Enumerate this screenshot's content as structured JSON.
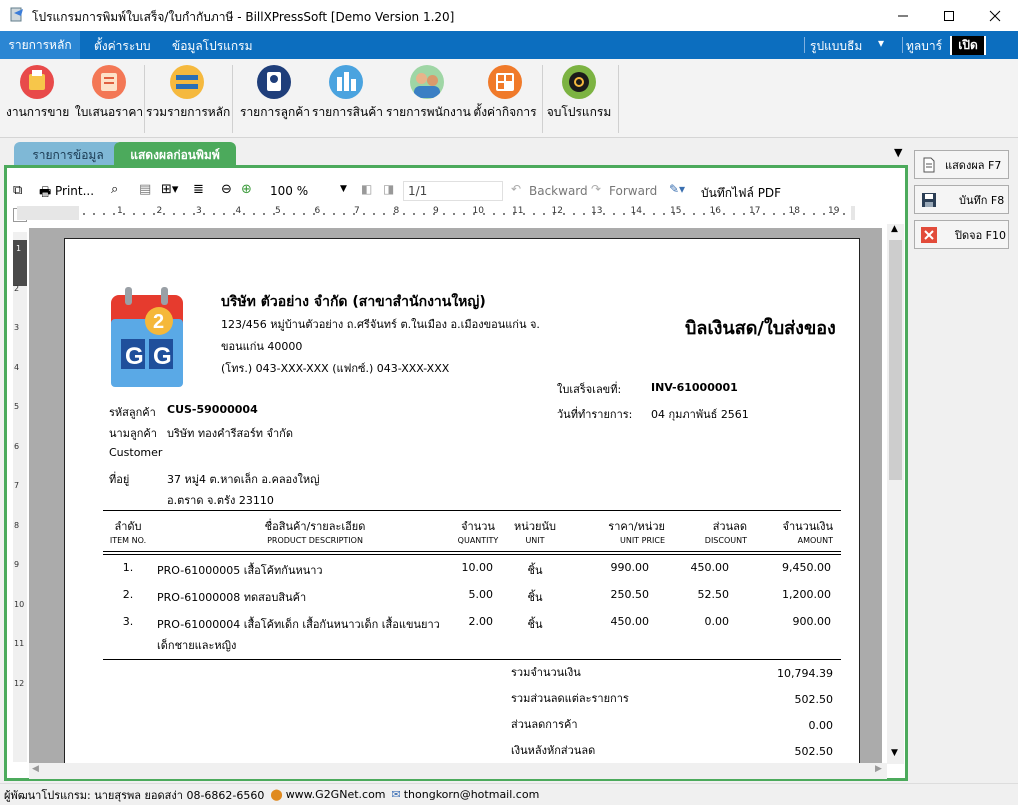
{
  "window": {
    "title": "โปรแกรมการพิมพ์ใบเสร็จ/ใบกำกับภาษี - BillXPressSoft [Demo Version 1.20]"
  },
  "ribbon_tabs": {
    "home": "รายการหลัก",
    "settings": "ตั้งค่าระบบ",
    "program_info": "ข้อมูลโปรแกรม",
    "theme": "รูปแบบธีม",
    "toolbar": "ทูลบาร์",
    "open": "เปิด"
  },
  "ribbon_buttons": [
    {
      "label": "งานการขาย",
      "icon": "sales-icon"
    },
    {
      "label": "ใบเสนอราคา",
      "icon": "quotation-icon"
    },
    {
      "label": "รวมรายการหลัก",
      "icon": "merge-icon"
    },
    {
      "label": "รายการลูกค้า",
      "icon": "customer-icon"
    },
    {
      "label": "รายการสินค้า",
      "icon": "product-icon"
    },
    {
      "label": "รายการพนักงาน",
      "icon": "employee-icon"
    },
    {
      "label": "ตั้งค่ากิจการ",
      "icon": "business-settings-icon"
    },
    {
      "label": "จบโปรแกรม",
      "icon": "power-icon"
    }
  ],
  "doc_tabs": {
    "data_list": "รายการข้อมูล",
    "preview": "แสดงผลก่อนพิมพ์"
  },
  "preview_toolbar": {
    "print": "Print...",
    "zoom": "100 %",
    "page": "1/1",
    "backward": "Backward",
    "forward": "Forward",
    "save_pdf": "บันทึกไฟล์ PDF"
  },
  "side_buttons": {
    "show": "แสดงผล F7",
    "save": "บันทึก F8",
    "close": "ปิดจอ F10"
  },
  "invoice": {
    "company_name": "บริษัท ตัวอย่าง จำกัด (สาขาสำนักงานใหญ่)",
    "address_line1": "123/456 หมู่บ้านตัวอย่าง ถ.ศรีจันทร์ ต.ในเมือง อ.เมืองขอนแก่น จ.",
    "address_line2": "ขอนแก่น 40000",
    "phone": "(โทร.) 043-XXX-XXX  (แฟกซ์.) 043-XXX-XXX",
    "doc_title": "บิลเงินสด/ใบส่งของ",
    "logo_text": "2G G",
    "receipt_no_label": "ใบเสร็จเลขที่:",
    "receipt_no": "INV-61000001",
    "date_label": "วันที่ทำรายการ:",
    "date": "04 กุมภาพันธ์ 2561",
    "customer_code_label": "รหัสลูกค้า",
    "customer_code": "CUS-59000004",
    "customer_name_label": "นามลูกค้า",
    "customer_name": "บริษัท ทองคำรีสอร์ท จำกัด",
    "customer_label_en": "Customer",
    "address_label": "ที่อยู่",
    "customer_address1": "37 หมู่4 ต.หาดเล็ก อ.คลองใหญ่",
    "customer_address2": "อ.ตราด จ.ตรัง 23110",
    "columns": [
      {
        "th": "ลำดับ",
        "en": "ITEM NO."
      },
      {
        "th": "ชื่อสินค้า/รายละเอียด",
        "en": "PRODUCT DESCRIPTION"
      },
      {
        "th": "จำนวน",
        "en": "QUANTITY"
      },
      {
        "th": "หน่วยนับ",
        "en": "UNIT"
      },
      {
        "th": "ราคา/หน่วย",
        "en": "UNIT PRICE"
      },
      {
        "th": "ส่วนลด",
        "en": "DISCOUNT"
      },
      {
        "th": "จำนวนเงิน",
        "en": "AMOUNT"
      }
    ],
    "rows": [
      {
        "no": "1.",
        "desc": "PRO-61000005 เสื้อโค้ทกันหนาว",
        "desc2": "",
        "qty": "10.00",
        "unit": "ชิ้น",
        "price": "990.00",
        "discount": "450.00",
        "amount": "9,450.00"
      },
      {
        "no": "2.",
        "desc": "PRO-61000008 ทดสอบสินค้า",
        "desc2": "",
        "qty": "5.00",
        "unit": "ชิ้น",
        "price": "250.50",
        "discount": "52.50",
        "amount": "1,200.00"
      },
      {
        "no": "3.",
        "desc": "PRO-61000004 เสื้อโค้ทเด็ก เสื้อกันหนาวเด็ก เสื้อแขนยาว",
        "desc2": "เด็กชายและหญิง",
        "qty": "2.00",
        "unit": "ชิ้น",
        "price": "450.00",
        "discount": "0.00",
        "amount": "900.00"
      }
    ],
    "totals": [
      {
        "label": "รวมจำนวนเงิน",
        "value": "10,794.39"
      },
      {
        "label": "รวมส่วนลดแต่ละรายการ",
        "value": "502.50"
      },
      {
        "label": "ส่วนลดการค้า",
        "value": "0.00"
      },
      {
        "label": "เงินหลังหักส่วนลด",
        "value": "502.50"
      }
    ]
  },
  "status_bar": {
    "developer": "ผู้พัฒนาโปรแกรม: นายสุรพล ยอดสง่า 08-6862-6560",
    "website": "www.G2GNet.com",
    "email": "thongkorn@hotmail.com"
  },
  "ruler_numbers": [
    "1",
    "2",
    "3",
    "4",
    "5",
    "6",
    "7",
    "8",
    "9",
    "10",
    "11",
    "12",
    "13",
    "14",
    "15",
    "16",
    "17",
    "18",
    "19"
  ],
  "ruler_v_numbers": [
    "1",
    "2",
    "3",
    "4",
    "5",
    "6",
    "7",
    "8",
    "9",
    "10",
    "11",
    "12"
  ],
  "colors": {
    "ribbon_blue": "#0c6ebf",
    "preview_tab_green": "#4caa5c",
    "data_tab_blue": "#7fb8d6"
  }
}
